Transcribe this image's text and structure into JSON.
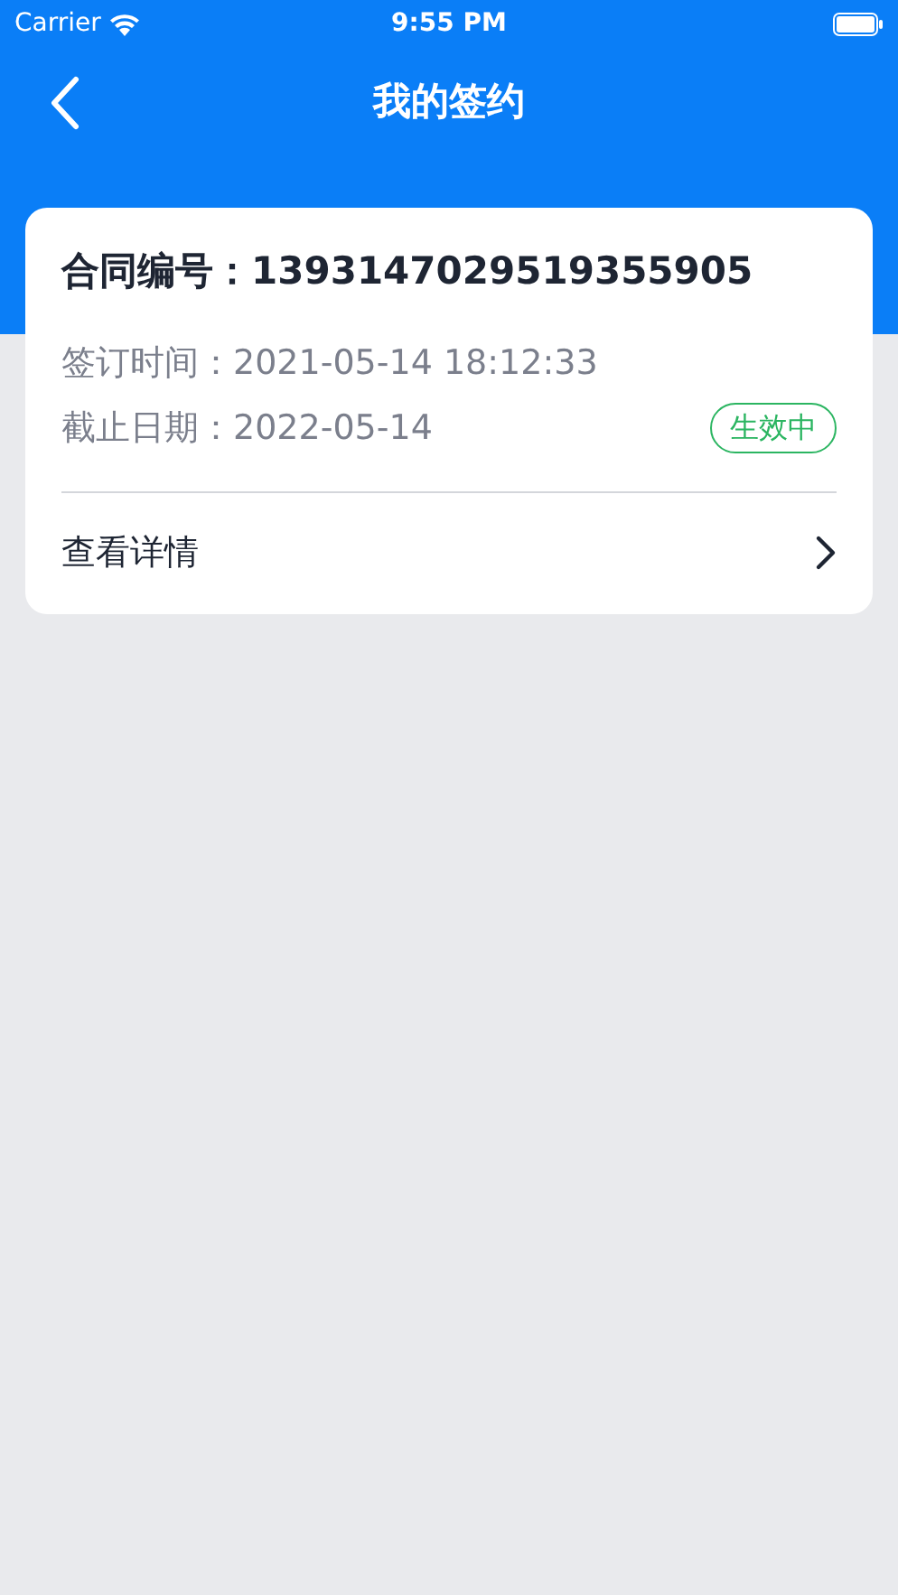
{
  "status_bar": {
    "carrier": "Carrier",
    "time": "9:55 PM"
  },
  "nav_bar": {
    "title": "我的签约"
  },
  "contracts": [
    {
      "number": "合同编号：1393147029519355905",
      "signed": "签订时间：2021-05-14 18:12:33",
      "deadline": "截止日期：2022-05-14",
      "status": "生效中",
      "color": "#2bb561",
      "link": "查看详情"
    }
  ]
}
